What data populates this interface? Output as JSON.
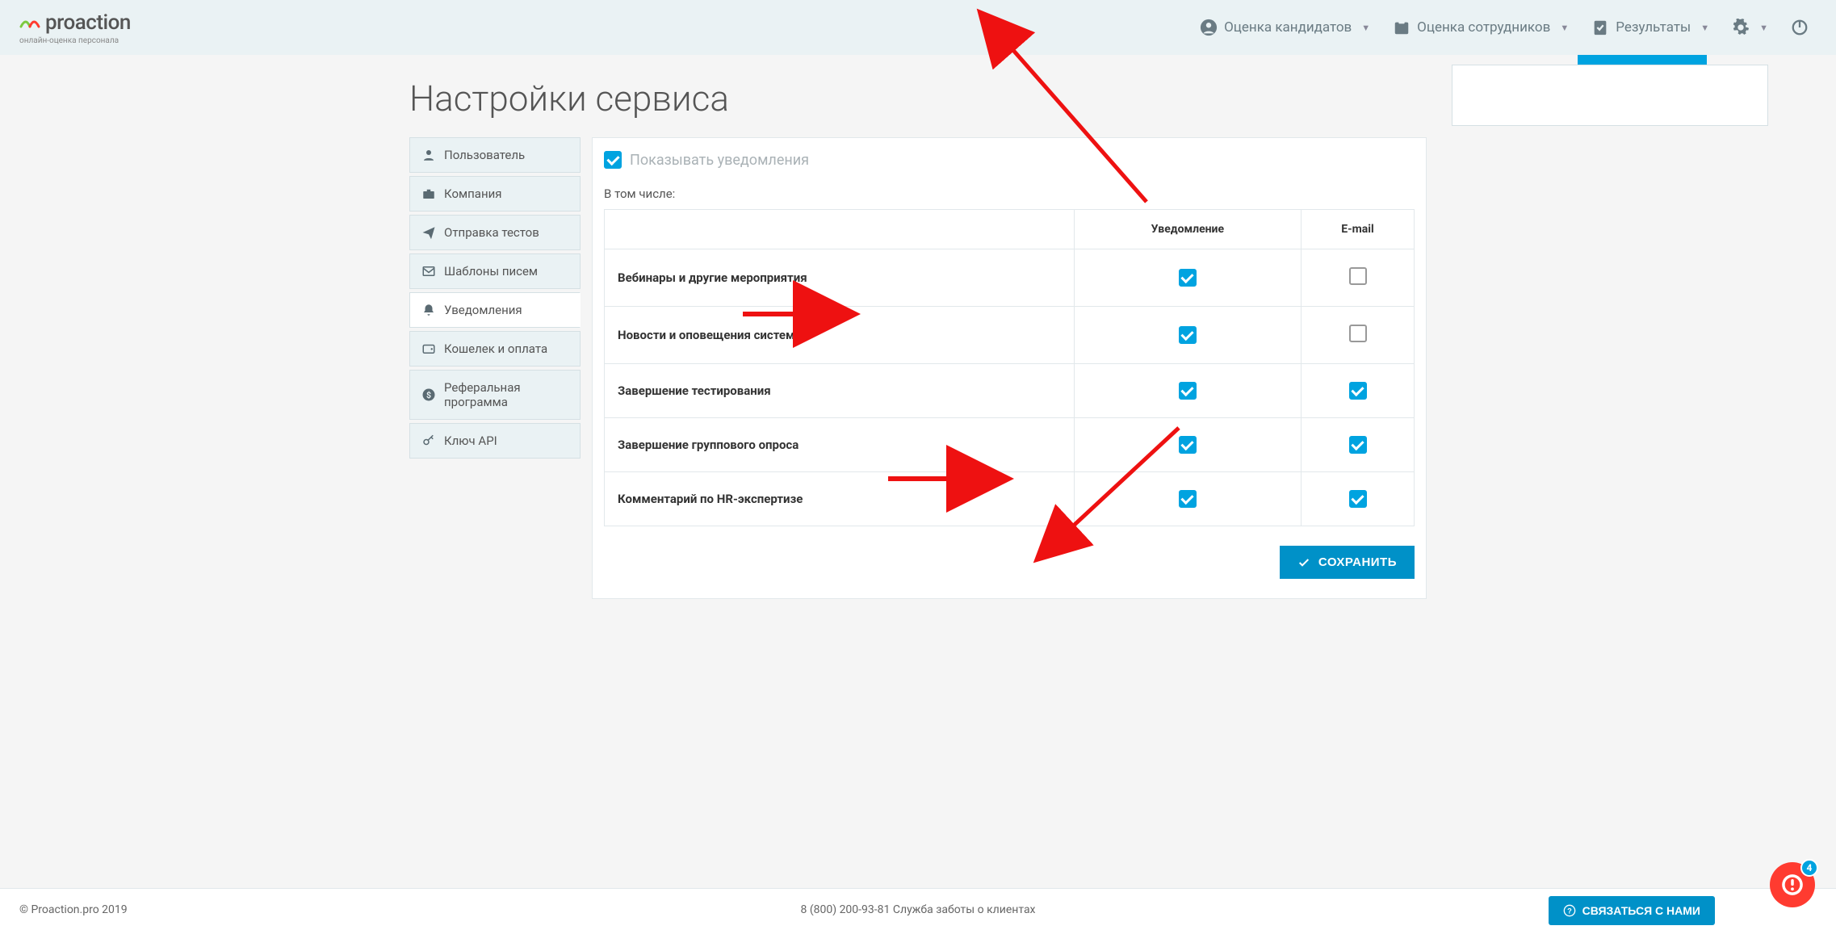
{
  "header": {
    "logo_text": "proaction",
    "logo_tagline": "онлайн-оценка персонала",
    "nav": {
      "candidates": "Оценка кандидатов",
      "employees": "Оценка сотрудников",
      "results": "Результаты"
    }
  },
  "page_title": "Настройки сервиса",
  "sidebar": {
    "items": [
      {
        "label": "Пользователь",
        "icon": "person"
      },
      {
        "label": "Компания",
        "icon": "briefcase"
      },
      {
        "label": "Отправка тестов",
        "icon": "send"
      },
      {
        "label": "Шаблоны писем",
        "icon": "mail"
      },
      {
        "label": "Уведомления",
        "icon": "bell",
        "active": true
      },
      {
        "label": "Кошелек и оплата",
        "icon": "wallet"
      },
      {
        "label": "Реферальная программа",
        "icon": "dollar"
      },
      {
        "label": "Ключ API",
        "icon": "key"
      }
    ]
  },
  "panel": {
    "show_notifications_label": "Показывать уведомления",
    "including_label": "В том числе:",
    "columns": {
      "notification": "Уведомление",
      "email": "E-mail"
    },
    "rows": [
      {
        "label": "Вебинары и другие мероприятия",
        "notification": true,
        "email": false
      },
      {
        "label": "Новости и оповещения системы",
        "notification": true,
        "email": false
      },
      {
        "label": "Завершение тестирования",
        "notification": true,
        "email": true
      },
      {
        "label": "Завершение группового опроса",
        "notification": true,
        "email": true
      },
      {
        "label": "Комментарий по HR-экспертизе",
        "notification": true,
        "email": true
      }
    ],
    "save_label": "СОХРАНИТЬ"
  },
  "footer": {
    "copyright": "© Proaction.pro 2019",
    "phone": "8 (800) 200-93-81 Служба заботы о клиентах",
    "contact_label": "СВЯЗАТЬСЯ С НАМИ"
  },
  "fab": {
    "badge_count": "4"
  }
}
